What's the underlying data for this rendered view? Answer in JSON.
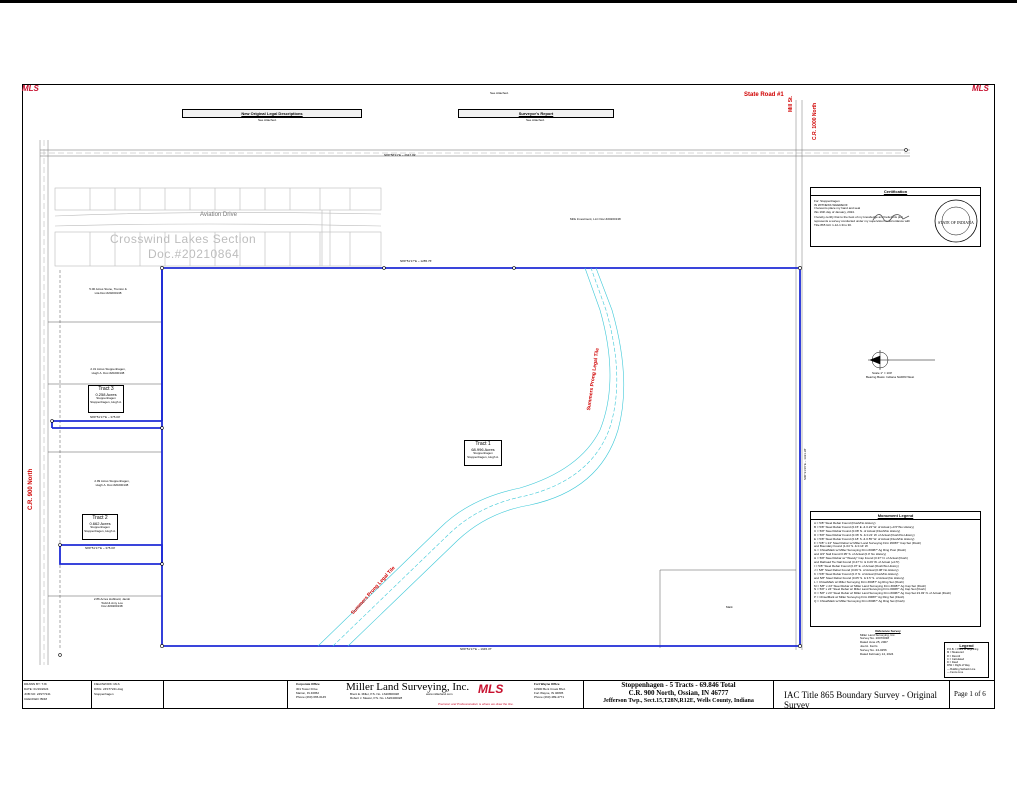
{
  "brand": {
    "left": "MLS",
    "right": "MLS"
  },
  "header": {
    "left_title": "New Original Legal Descriptions",
    "left_sub": "See Attached.",
    "right_title": "Surveyor's Report",
    "right_sub": "See Attached.",
    "top_note": "See Attached."
  },
  "roads": {
    "state_road": "State Road #1",
    "mill_st": "Mill St.",
    "cr1000": "C.R. 1000 North",
    "cr900": "C.R. 900 North",
    "aviation": "Aviation Drive",
    "subdivision": "Crosswind Lakes Section",
    "doc": "Doc.#20210864"
  },
  "tracts": {
    "t1": {
      "name": "Tract 1",
      "acres": "68.996 Acres",
      "owner": "Stoppenhagen",
      "book": "Stoppenhagen, Hugh A."
    },
    "t2": {
      "name": "Tract 2",
      "acres": "0.662 Acres",
      "owner": "Stoppenhagen",
      "book": "Stoppenhagen, Hugh A."
    },
    "t3": {
      "name": "Tract 3",
      "acres": "0.258 Acres",
      "owner": "Stoppenhagen",
      "book": "Stoppenhagen, Hugh A."
    }
  },
  "drains": {
    "left": "Summers Prong Legal Tile",
    "upper": "Summers Prong Legal Tile"
  },
  "certification": {
    "title": "Certification",
    "lines": [
      "For: Stoppenhagen",
      "IN WITNESS WHEREOF",
      "I hereunto place my hand and seal",
      "this 19th day of January, 2024.",
      "I hereby certify that to the best of my knowledge and belief this plat",
      "represents a survey conducted under my supervision in accordance with",
      "Title 865 IAC 1-12-1 thru 30."
    ],
    "seal": "STATE OF INDIANA"
  },
  "legend": {
    "title": "Monument Legend",
    "items": [
      "A = 5/8\" Steel Rebar Found (Flush/No History)",
      "B = 5/8\" Steel Rebar Found (0.15' E. & 0.23' W. of Actual (+0.5\"/No History)",
      "C = 5/8\" Steel Rebar Found (0.08' N. of Actual (Flush/No History)",
      "D = 5/8\" Steel Rebar Found (0.36' N. & 0.21' W. of Actual (Flush/No History)",
      "E = 5/8\" Steel Rebar Found (0.18' S. & 0.55' W. of Actual (Flush/No History)",
      "F = 5/8\" x 24\" Steel Rebar w/ Miller Land Surveying Firm #0087\" Cap Set (Flush)",
      "    and Boundary Found (1.04' S. & 0.14' W.",
      "G = ChiselMark w/ Miller Surveying Firm #0087\" Ag Ring Post (Flush)",
      "    and 3/4\" Nail Found 0.95' S. of Actual (0.0' No History)",
      "H = 5/8\" Steel Rebar w/ \"Woody\" Cap Found (0.37' N. of Actual (Flush)",
      "    and Railroad Tie Nail Found (0.47' N. & 0.29' W. of Actual (+0.5')",
      "I = 5/8\" Steel Rebar Found (0.07' E. of Actual (Flush/No History)",
      "J = 5/8\" Steel Rebar Found (0.09' S. of Actual (0.08' No History)",
      "K = 5/8\" Steel Rebar Found (0.3' N. of Actual (Flush/No History)",
      "    and 5/8\" Steel Rebar Found (0.05' S. & 3.5' S. of Actual (No History)",
      "L = ChiselMark w/ Miller Surveying Firm #0087\" Ag Ring Set (Flush)",
      "M = 5/8\" x 24\" Steel Rebar w/ Miller Land Surveying Firm #0087\" Ag Cap Set (Flush)",
      "N = 5/8\" x 24\" Steel Rebar w/ Miller Land Surveying Firm #0087\" Ag Cap Set (Flush)",
      "O = 5/8\" x 24\" Steel Rebar w/ Miller Land Surveying Firm #0087\" Ag Cap Set 23.03' N. of Actual (Flush)",
      "P = ChiselMark w/ Miller Surveying Firm #0087\" Ag Ring Set (Flush)",
      "Q = ChiselMark w/ Miller Surveying Firm #0087\" Ag Ring Set (Flush)"
    ]
  },
  "reference": {
    "title": "Reference Survey",
    "lines": [
      "Miller Land Surveying, Inc.",
      "Survey No. 20070038",
      "Dated June 25, 2007",
      "Joel A. Ferris",
      "Survey No. 24-0256",
      "Dated February 14, 2024"
    ]
  },
  "small_legend": {
    "title": "Legend",
    "rows": [
      "P.O.B. = Point of Beginning",
      "M = Measured",
      "R = Record",
      "C = Calculated",
      "D = Deed",
      "R/W = Right of Way",
      "--- Building Setback Line",
      "--- Fence Line"
    ]
  },
  "titleblock": {
    "drawn": "DRAWN BY: TJK",
    "date": "DATE: 01/19/2024",
    "field": "FIELDWORK: MLS",
    "job": "JOB NO: 24ST7241",
    "checked": "CHECKED: BDM",
    "dwg": "DWG: 24ST7241.dwg",
    "client": "Stoppenhagen",
    "company": "Miller Land Surveying, Inc.",
    "corp_office": "Corporate Office",
    "corp_addr": [
      "301 Tower Drive",
      "Marion, IN 46952",
      "Phone (260) 665-6145"
    ],
    "fw_office": "Fort Wayne Office",
    "fw_addr": [
      "10900 Bent Creek Blvd.",
      "Fort Wayne, IN 46805",
      "Phone (260) 489-4771"
    ],
    "principals": [
      "Brent E. Miller, P.S. No. LS20800028",
      "Robert J. Mewer, P.S. No. LS20400028"
    ],
    "website": "www.millerland.com",
    "tagline": "Precision and Professionalism is where we draw the line.",
    "project_lines": [
      "Stoppenhagen - 5 Tracts - 69.846 Total",
      "C.R. 900 North, Ossian, IN 46777",
      "Jefferson Twp., Sect.15,T28N,R12E, Wells County, Indiana"
    ],
    "survey_title": "IAC Title 865 Boundary Survey - Original Survey",
    "page": "Page 1 of 6"
  },
  "bearings": {
    "north_line": "N89°51'17\"E ~ 1285.76'",
    "top_road": "N89°58'21\"E ~ 2647.99'",
    "south_line": "N89°51'17\"E ~ 1945.37'",
    "east_line": "S00°31'26\"E ~ 1321.38'",
    "tract3_n": "N89°51'17\"E ~ 375.00'",
    "tract2_n": "N89°51'17\"E ~ 375.00'",
    "north_arrow": "Bearing Basis: Indiana NAD83 West",
    "scale": "Scale 1\" = 100'"
  },
  "misc": {
    "mills_parcel": "Mills Investment, LLC Doc.#20200138",
    "n_parcel": "5.00 Acres Stone, Trenton & Lita Doc.#20200138",
    "p2": "2.31 Acres Stoppenhagen, Hugh A. Doc.#20200138",
    "p3": "2.99 Acres Stoppenhagen, Hugh A. Doc.#20200138",
    "p4": "2.86 Acres Hubbard, Jacob Todd & Amy Lou Doc.#20200138",
    "mark": "Mark"
  }
}
